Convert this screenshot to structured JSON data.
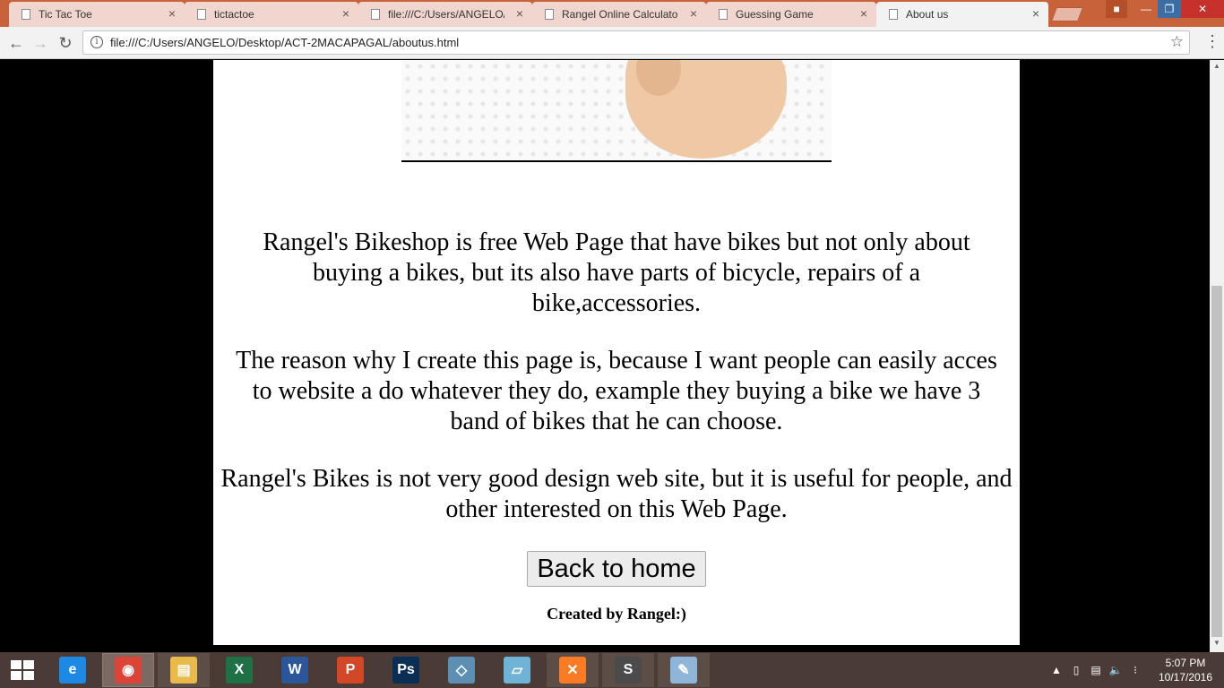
{
  "tabs": [
    {
      "title": "Tic Tac Toe",
      "active": false
    },
    {
      "title": "tictactoe",
      "active": false
    },
    {
      "title": "file:///C:/Users/ANGELO/",
      "active": false
    },
    {
      "title": "Rangel Online Calculator",
      "active": false
    },
    {
      "title": "Guessing Game",
      "active": false
    },
    {
      "title": "About us",
      "active": true
    }
  ],
  "tab_close_glyph": "×",
  "toolbar": {
    "url": "file:///C:/Users/ANGELO/Desktop/ACT-2MACAPAGAL/aboutus.html",
    "info_glyph": "i"
  },
  "page": {
    "paragraph1": "Rangel's Bikeshop is free Web Page that have bikes but not only about buying a bikes, but its also have parts of bicycle, repairs of a bike,accessories.",
    "paragraph2": "The reason why I create this page is, because I want people can easily acces to website a do whatever they do, example they buying a bike we have 3 band of bikes that he can choose.",
    "paragraph3": "Rangel's Bikes is not very good design web site, but it is useful for people, and other interested on this Web Page.",
    "back_button": "Back to home",
    "credit": "Created by Rangel:)"
  },
  "taskbar": {
    "apps": [
      {
        "name": "internet-explorer",
        "glyph": "e",
        "color": "#1e88e5",
        "state": "pinned"
      },
      {
        "name": "chrome",
        "glyph": "◉",
        "color": "#db4437",
        "state": "active"
      },
      {
        "name": "file-explorer",
        "glyph": "▤",
        "color": "#e9b949",
        "state": "open"
      },
      {
        "name": "excel",
        "glyph": "X",
        "color": "#1e7145",
        "state": "pinned"
      },
      {
        "name": "word",
        "glyph": "W",
        "color": "#2b579a",
        "state": "pinned"
      },
      {
        "name": "powerpoint",
        "glyph": "P",
        "color": "#d24726",
        "state": "pinned"
      },
      {
        "name": "photoshop",
        "glyph": "Ps",
        "color": "#0b2e55",
        "state": "pinned"
      },
      {
        "name": "mysql-installer",
        "glyph": "◇",
        "color": "#5d8fb5",
        "state": "pinned"
      },
      {
        "name": "notepad",
        "glyph": "▱",
        "color": "#6fb3d6",
        "state": "pinned"
      },
      {
        "name": "xampp",
        "glyph": "✕",
        "color": "#fb7a24",
        "state": "open"
      },
      {
        "name": "sublime-text",
        "glyph": "S",
        "color": "#4b4b4b",
        "state": "open"
      },
      {
        "name": "paint",
        "glyph": "✎",
        "color": "#8fb6d9",
        "state": "open"
      }
    ],
    "clock_time": "5:07 PM",
    "clock_date": "10/17/2016"
  }
}
